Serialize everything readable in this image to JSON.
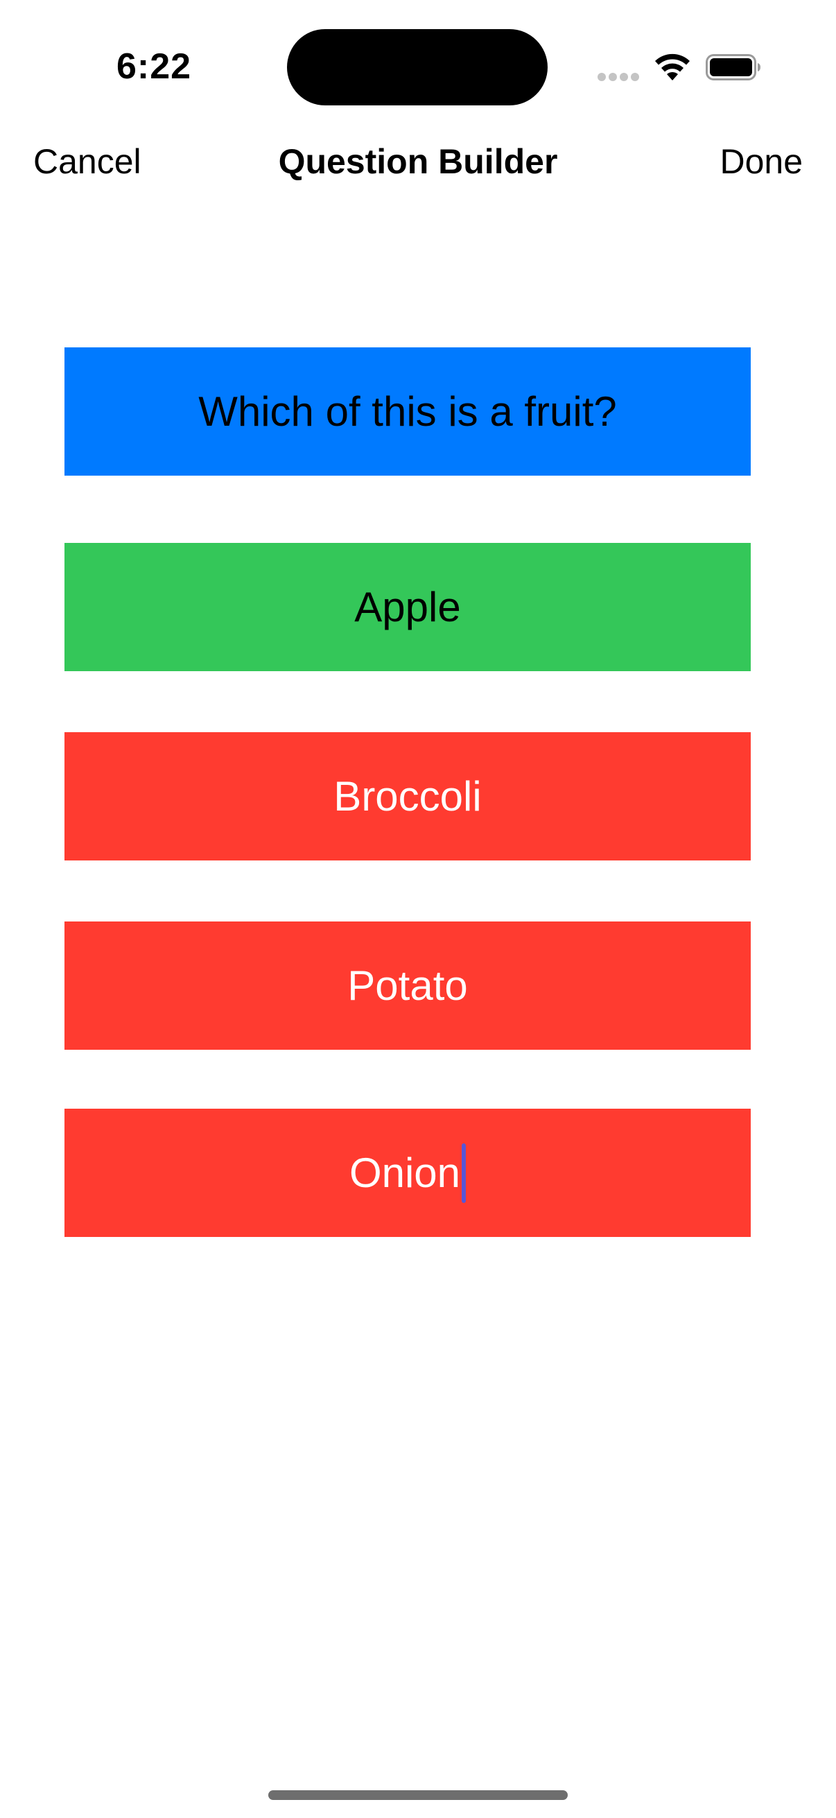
{
  "status_bar": {
    "time": "6:22"
  },
  "nav": {
    "cancel_label": "Cancel",
    "title": "Question Builder",
    "done_label": "Done"
  },
  "question": {
    "text": "Which of this is a fruit?",
    "color": "#007aff"
  },
  "answers": {
    "correct": {
      "text": "Apple",
      "color": "#34c759"
    },
    "wrong": [
      {
        "text": "Broccoli",
        "color": "#ff3b30"
      },
      {
        "text": "Potato",
        "color": "#ff3b30"
      },
      {
        "text": "Onion",
        "color": "#ff3b30"
      }
    ]
  },
  "icons": {
    "signal": "cellular-signal-icon",
    "wifi": "wifi-icon",
    "battery": "battery-icon"
  },
  "cursor_color": "#5856d6"
}
